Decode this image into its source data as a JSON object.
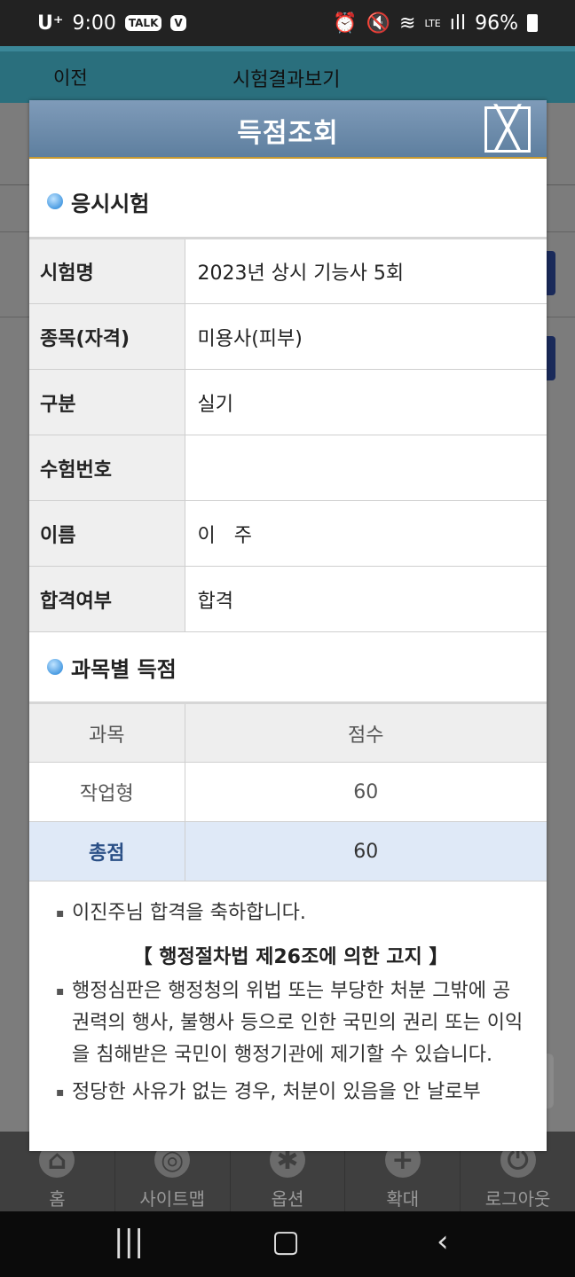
{
  "status": {
    "carrier": "U⁺",
    "time": "9:00",
    "talk": "TALK",
    "v": "V",
    "battery": "96%",
    "signal": "LTE"
  },
  "underlying": {
    "prev": "이전",
    "title": "시험결과보기"
  },
  "modal": {
    "title": "득점조회",
    "close_glyph": "╳",
    "section1_title": "응시시험",
    "fields": [
      {
        "label": "시험명",
        "value": "2023년 상시 기능사 5회"
      },
      {
        "label": "종목(자격)",
        "value": "미용사(피부)"
      },
      {
        "label": "구분",
        "value": "실기"
      },
      {
        "label": "수험번호",
        "value": ""
      },
      {
        "label": "이름",
        "value": "이   주"
      },
      {
        "label": "합격여부",
        "value": "합격"
      }
    ],
    "section2_title": "과목별 득점",
    "score_header": {
      "subject": "과목",
      "score": "점수"
    },
    "scores": [
      {
        "subject": "작업형",
        "score": "60"
      }
    ],
    "total": {
      "label": "총점",
      "score": "60"
    },
    "congrats": "이진주님 합격을 축하합니다.",
    "notice_title": "【 행정절차법 제26조에 의한 고지 】",
    "notice1": "행정심판은 행정청의 위법 또는 부당한 처분 그밖에 공권력의 행사, 불행사 등으로 인한 국민의 권리 또는 이익을 침해받은 국민이 행정기관에 제기할 수 있습니다.",
    "notice2": "정당한 사유가 없는 경우, 처분이 있음을 안 날로부"
  },
  "bottom_nav": [
    "홈",
    "사이트맵",
    "옵션",
    "확대",
    "로그아웃"
  ],
  "colors": {
    "header": "#6f8dad",
    "accent_gold": "#c79a33",
    "total_row": "#dfe9f7"
  }
}
